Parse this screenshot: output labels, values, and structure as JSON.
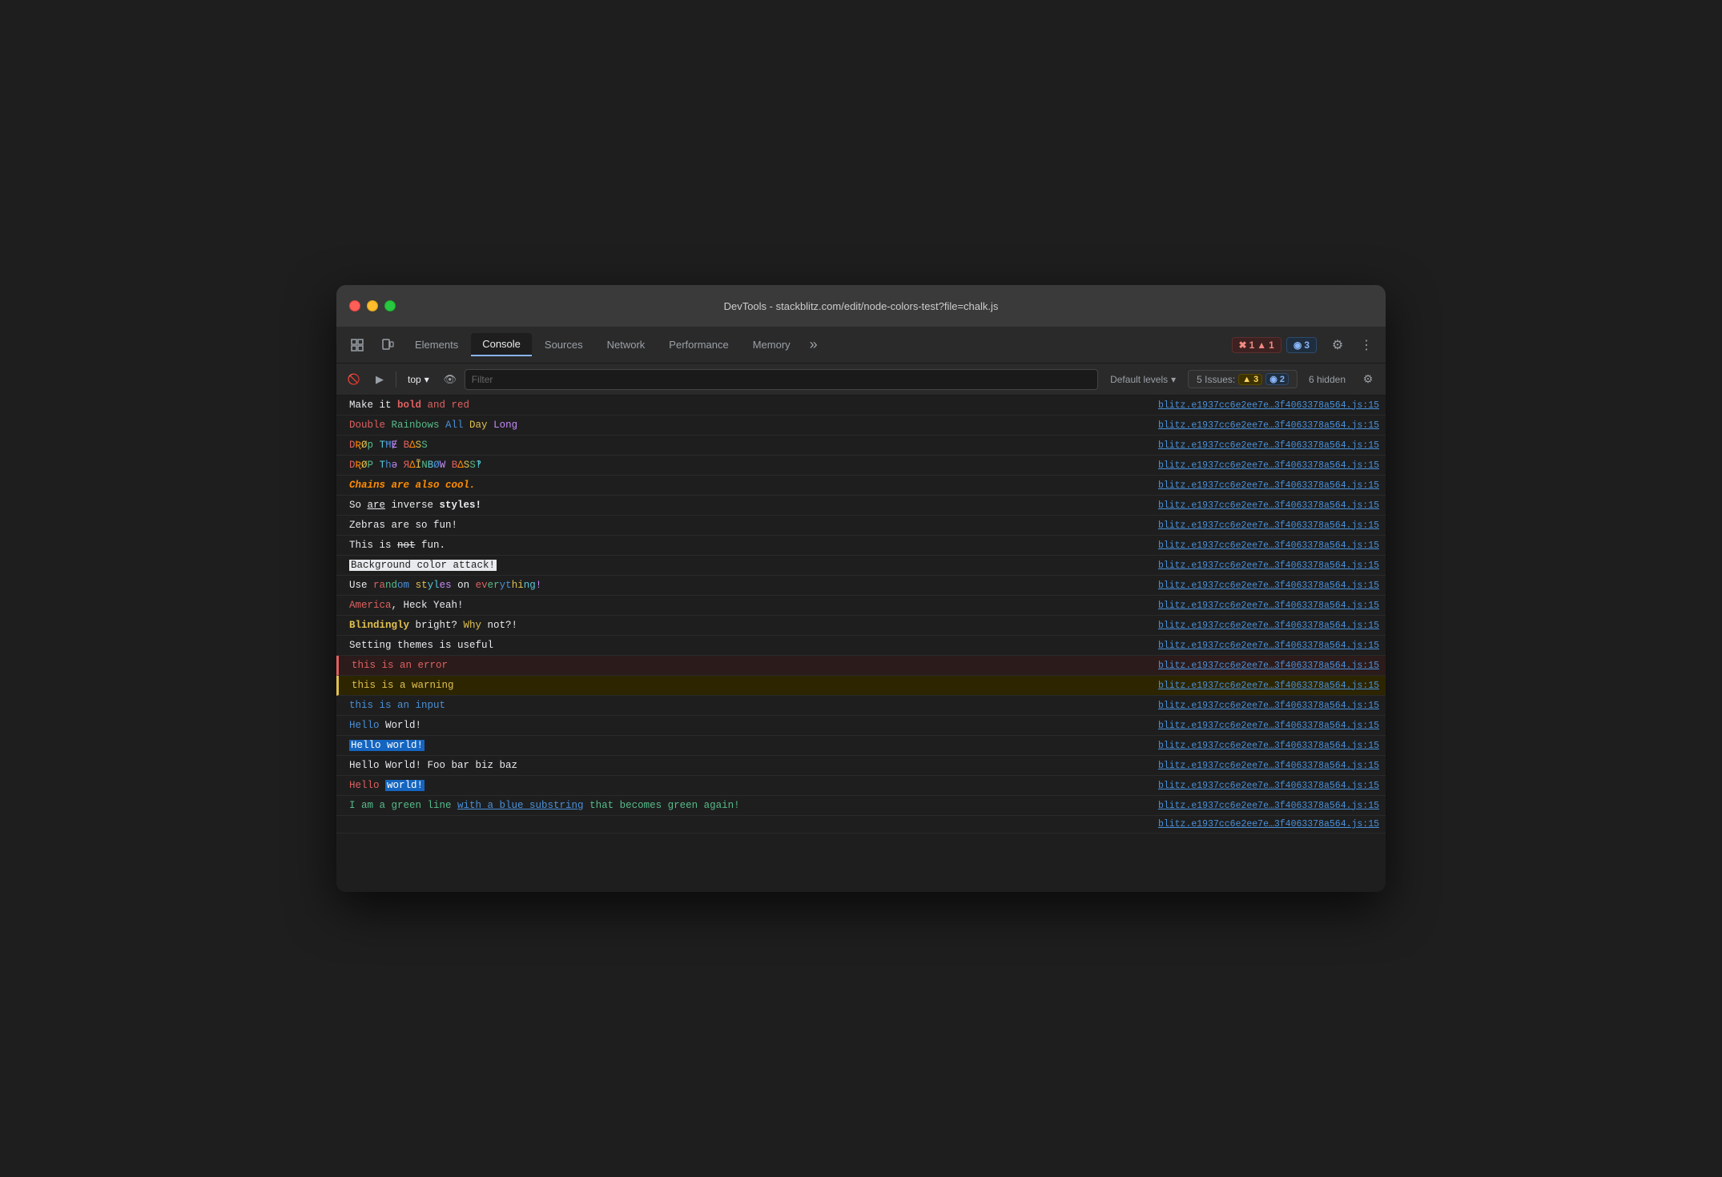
{
  "window": {
    "title": "DevTools - stackblitz.com/edit/node-colors-test?file=chalk.js"
  },
  "tabs": {
    "items": [
      {
        "id": "elements",
        "label": "Elements",
        "active": false
      },
      {
        "id": "console",
        "label": "Console",
        "active": true
      },
      {
        "id": "sources",
        "label": "Sources",
        "active": false
      },
      {
        "id": "network",
        "label": "Network",
        "active": false
      },
      {
        "id": "performance",
        "label": "Performance",
        "active": false
      },
      {
        "id": "memory",
        "label": "Memory",
        "active": false
      }
    ],
    "more": "»",
    "badges": {
      "red_icon": "✖",
      "red_count": "1",
      "yellow_icon": "▲",
      "yellow_count": "1",
      "blue_icon": "◉",
      "blue_count": "3"
    }
  },
  "toolbar": {
    "top_label": "top",
    "filter_placeholder": "Filter",
    "levels_label": "Default levels",
    "issues_label": "5 Issues:",
    "issues_warn_count": "3",
    "issues_msg_count": "2",
    "hidden_label": "6 hidden"
  },
  "console_rows": [
    {
      "id": 1,
      "source": "blitz.e1937cc6e2ee7e…3f4063378a564.js:15",
      "type": "normal",
      "segments": [
        {
          "text": "Make it ",
          "style": ""
        },
        {
          "text": "bold",
          "style": "t-bold c-red"
        },
        {
          "text": " and ",
          "style": "c-red"
        },
        {
          "text": "red",
          "style": "c-red"
        }
      ]
    },
    {
      "id": 2,
      "source": "blitz.e1937cc6e2ee7e…3f4063378a564.js:15",
      "type": "normal",
      "segments": [
        {
          "text": "Double ",
          "style": "c-red"
        },
        {
          "text": "Rainbows",
          "style": "c-green"
        },
        {
          "text": " All ",
          "style": "c-blue"
        },
        {
          "text": "Day",
          "style": "c-yellow"
        },
        {
          "text": " Long",
          "style": "c-magenta"
        }
      ]
    },
    {
      "id": 3,
      "source": "blitz.e1937cc6e2ee7e…3f4063378a564.js:15",
      "type": "normal",
      "segments": [
        {
          "text": "D",
          "style": "c-red"
        },
        {
          "text": "Ʀ",
          "style": "c-orange"
        },
        {
          "text": "Ø",
          "style": "c-yellow"
        },
        {
          "text": "p",
          "style": "c-green"
        },
        {
          "text": " ",
          "style": ""
        },
        {
          "text": "T",
          "style": "c-cyan"
        },
        {
          "text": "Ħ",
          "style": "c-blue"
        },
        {
          "text": "Ɇ",
          "style": "c-magenta"
        },
        {
          "text": " ",
          "style": ""
        },
        {
          "text": "B",
          "style": "c-red"
        },
        {
          "text": "Δ",
          "style": "c-orange"
        },
        {
          "text": "S",
          "style": "c-yellow"
        },
        {
          "text": "S",
          "style": "c-green"
        }
      ]
    },
    {
      "id": 4,
      "source": "blitz.e1937cc6e2ee7e…3f4063378a564.js:15",
      "type": "normal",
      "segments": [
        {
          "text": "D",
          "style": "c-red"
        },
        {
          "text": "Ʀ",
          "style": "c-orange"
        },
        {
          "text": "Ø",
          "style": "c-yellow"
        },
        {
          "text": "P",
          "style": "c-green"
        },
        {
          "text": " ",
          "style": ""
        },
        {
          "text": "T",
          "style": "c-cyan"
        },
        {
          "text": "h",
          "style": "c-blue"
        },
        {
          "text": "ə",
          "style": "c-magenta"
        },
        {
          "text": " ",
          "style": ""
        },
        {
          "text": "Я",
          "style": "c-red"
        },
        {
          "text": "Δ",
          "style": "c-orange"
        },
        {
          "text": "Ĩ",
          "style": "c-yellow"
        },
        {
          "text": "N",
          "style": "c-green"
        },
        {
          "text": "B",
          "style": "c-cyan"
        },
        {
          "text": "Ø",
          "style": "c-blue"
        },
        {
          "text": "W",
          "style": "c-magenta"
        },
        {
          "text": " ",
          "style": ""
        },
        {
          "text": "B",
          "style": "c-red"
        },
        {
          "text": "Δ",
          "style": "c-orange"
        },
        {
          "text": "S",
          "style": "c-yellow"
        },
        {
          "text": "S",
          "style": "c-green"
        },
        {
          "text": "‽",
          "style": "c-cyan"
        }
      ]
    },
    {
      "id": 5,
      "source": "blitz.e1937cc6e2ee7e…3f4063378a564.js:15",
      "type": "normal",
      "segments": [
        {
          "text": "Chains are also cool.",
          "style": "c-orange t-italic t-bold"
        }
      ]
    },
    {
      "id": 6,
      "source": "blitz.e1937cc6e2ee7e…3f4063378a564.js:15",
      "type": "normal",
      "segments": [
        {
          "text": "So ",
          "style": ""
        },
        {
          "text": "are",
          "style": "t-underline"
        },
        {
          "text": " inverse ",
          "style": ""
        },
        {
          "text": "styles!",
          "style": "t-bold"
        }
      ]
    },
    {
      "id": 7,
      "source": "blitz.e1937cc6e2ee7e…3f4063378a564.js:15",
      "type": "normal",
      "segments": [
        {
          "text": "Zebras are so fun!",
          "style": ""
        }
      ]
    },
    {
      "id": 8,
      "source": "blitz.e1937cc6e2ee7e…3f4063378a564.js:15",
      "type": "normal",
      "segments": [
        {
          "text": "This is ",
          "style": ""
        },
        {
          "text": "not",
          "style": "t-strikethrough"
        },
        {
          "text": " fun.",
          "style": ""
        }
      ]
    },
    {
      "id": 9,
      "source": "blitz.e1937cc6e2ee7e…3f4063378a564.js:15",
      "type": "normal",
      "segments": [
        {
          "text": "Background color attack!",
          "style": "bg-white"
        }
      ]
    },
    {
      "id": 10,
      "source": "blitz.e1937cc6e2ee7e…3f4063378a564.js:15",
      "type": "normal",
      "segments": [
        {
          "text": "Use ",
          "style": ""
        },
        {
          "text": "ra",
          "style": "c-red"
        },
        {
          "text": "nd",
          "style": "c-green"
        },
        {
          "text": "om",
          "style": "c-blue"
        },
        {
          "text": " ",
          "style": ""
        },
        {
          "text": "st",
          "style": "c-yellow"
        },
        {
          "text": "yl",
          "style": "c-cyan"
        },
        {
          "text": "es",
          "style": "c-magenta"
        },
        {
          "text": " on ",
          "style": ""
        },
        {
          "text": "ev",
          "style": "c-red"
        },
        {
          "text": "er",
          "style": "c-green"
        },
        {
          "text": "yt",
          "style": "c-blue"
        },
        {
          "text": "hi",
          "style": "c-yellow"
        },
        {
          "text": "ng",
          "style": "c-cyan"
        },
        {
          "text": "!",
          "style": "c-magenta"
        }
      ]
    },
    {
      "id": 11,
      "source": "blitz.e1937cc6e2ee7e…3f4063378a564.js:15",
      "type": "normal",
      "segments": [
        {
          "text": "America",
          "style": "c-red"
        },
        {
          "text": ", Heck Yeah!",
          "style": ""
        }
      ]
    },
    {
      "id": 12,
      "source": "blitz.e1937cc6e2ee7e…3f4063378a564.js:15",
      "type": "normal",
      "segments": [
        {
          "text": "Blindingly ",
          "style": "c-yellow t-bold"
        },
        {
          "text": "bright? ",
          "style": ""
        },
        {
          "text": "Why",
          "style": "c-yellow"
        },
        {
          "text": " not?!",
          "style": ""
        }
      ]
    },
    {
      "id": 13,
      "source": "blitz.e1937cc6e2ee7e…3f4063378a564.js:15",
      "type": "normal",
      "segments": [
        {
          "text": "Setting themes is useful",
          "style": ""
        }
      ]
    },
    {
      "id": 14,
      "source": "blitz.e1937cc6e2ee7e…3f4063378a564.js:15",
      "type": "error",
      "segments": [
        {
          "text": "this is an error",
          "style": "c-red"
        }
      ]
    },
    {
      "id": 15,
      "source": "blitz.e1937cc6e2ee7e…3f4063378a564.js:15",
      "type": "warning",
      "segments": [
        {
          "text": "this is a warning",
          "style": "c-yellow"
        }
      ]
    },
    {
      "id": 16,
      "source": "blitz.e1937cc6e2ee7e…3f4063378a564.js:15",
      "type": "normal",
      "segments": [
        {
          "text": "this is an input",
          "style": "c-blue"
        }
      ]
    },
    {
      "id": 17,
      "source": "blitz.e1937cc6e2ee7e…3f4063378a564.js:15",
      "type": "normal",
      "segments": [
        {
          "text": "Hello ",
          "style": "c-blue"
        },
        {
          "text": "World!",
          "style": ""
        }
      ]
    },
    {
      "id": 18,
      "source": "blitz.e1937cc6e2ee7e…3f4063378a564.js:15",
      "type": "normal",
      "segments": [
        {
          "text": "Hello world!",
          "style": "bg-blue"
        }
      ]
    },
    {
      "id": 19,
      "source": "blitz.e1937cc6e2ee7e…3f4063378a564.js:15",
      "type": "normal",
      "segments": [
        {
          "text": "Hello World! Foo bar biz baz",
          "style": ""
        }
      ]
    },
    {
      "id": 20,
      "source": "blitz.e1937cc6e2ee7e…3f4063378a564.js:15",
      "type": "normal",
      "segments": [
        {
          "text": "Hello ",
          "style": "c-red"
        },
        {
          "text": "world!",
          "style": "bg-blue"
        }
      ]
    },
    {
      "id": 21,
      "source": "blitz.e1937cc6e2ee7e…3f4063378a564.js:15",
      "type": "normal",
      "segments": [
        {
          "text": "I am a green line ",
          "style": "c-green"
        },
        {
          "text": "with a blue substring",
          "style": "c-blue t-underline"
        },
        {
          "text": " that becomes green again!",
          "style": "c-green"
        }
      ]
    },
    {
      "id": 22,
      "source": "blitz.e1937cc6e2ee7e…3f4063378a564.js:15",
      "type": "normal",
      "segments": [
        {
          "text": "",
          "style": ""
        }
      ]
    }
  ]
}
